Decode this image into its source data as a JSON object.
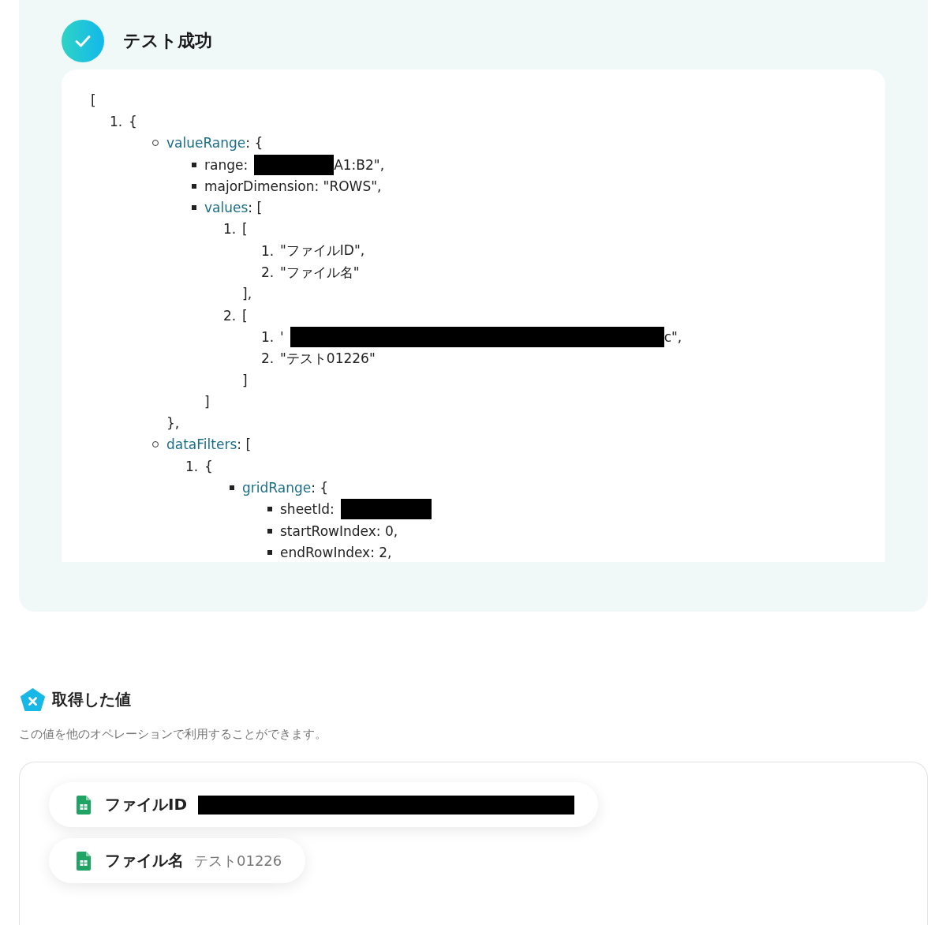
{
  "result": {
    "title": "テスト成功",
    "code": {
      "kind": "plain",
      "segments": [
        {
          "kind": "text",
          "text": "["
        }
      ],
      "children": [
        {
          "kind": "numbered",
          "number": "1.",
          "segments": [
            {
              "kind": "text",
              "text": "{"
            }
          ],
          "children": [
            {
              "kind": "circle",
              "segments": [
                {
                  "kind": "key",
                  "text": "valueRange"
                },
                {
                  "kind": "text",
                  "text": ": {"
                }
              ],
              "close": "},",
              "children": [
                {
                  "kind": "square",
                  "segments": [
                    {
                      "kind": "text",
                      "text": "range:"
                    },
                    {
                      "kind": "redaction"
                    },
                    {
                      "kind": "text",
                      "text": "A1:B2\","
                    }
                  ]
                },
                {
                  "kind": "square",
                  "segments": [
                    {
                      "kind": "text",
                      "text": "majorDimension: \"ROWS\","
                    }
                  ]
                },
                {
                  "kind": "square",
                  "segments": [
                    {
                      "kind": "key",
                      "text": "values"
                    },
                    {
                      "kind": "text",
                      "text": ": ["
                    }
                  ],
                  "close": "]",
                  "children": [
                    {
                      "kind": "numbered",
                      "number": "1.",
                      "segments": [
                        {
                          "kind": "text",
                          "text": "["
                        }
                      ],
                      "close": "],",
                      "children": [
                        {
                          "kind": "numbered",
                          "number": "1.",
                          "segments": [
                            {
                              "kind": "text",
                              "text": "\"ファイルID\","
                            }
                          ]
                        },
                        {
                          "kind": "numbered",
                          "number": "2.",
                          "segments": [
                            {
                              "kind": "text",
                              "text": "\"ファイル名\""
                            }
                          ]
                        }
                      ]
                    },
                    {
                      "kind": "numbered",
                      "number": "2.",
                      "segments": [
                        {
                          "kind": "text",
                          "text": "["
                        }
                      ],
                      "close": "]",
                      "children": [
                        {
                          "kind": "numbered",
                          "number": "1.",
                          "segments": [
                            {
                              "kind": "text",
                              "text": "'"
                            },
                            {
                              "kind": "redaction"
                            },
                            {
                              "kind": "text",
                              "text": "c\","
                            }
                          ]
                        },
                        {
                          "kind": "numbered",
                          "number": "2.",
                          "segments": [
                            {
                              "kind": "text",
                              "text": "\"テスト01226\""
                            }
                          ]
                        }
                      ]
                    }
                  ]
                }
              ]
            },
            {
              "kind": "circle",
              "segments": [
                {
                  "kind": "key",
                  "text": "dataFilters"
                },
                {
                  "kind": "text",
                  "text": ": ["
                }
              ],
              "children": [
                {
                  "kind": "numbered",
                  "number": "1.",
                  "segments": [
                    {
                      "kind": "text",
                      "text": "{"
                    }
                  ],
                  "children": [
                    {
                      "kind": "square",
                      "segments": [
                        {
                          "kind": "key",
                          "text": "gridRange"
                        },
                        {
                          "kind": "text",
                          "text": ": {"
                        }
                      ],
                      "children": [
                        {
                          "kind": "square",
                          "segments": [
                            {
                              "kind": "text",
                              "text": "sheetId:"
                            },
                            {
                              "kind": "redaction"
                            }
                          ]
                        },
                        {
                          "kind": "square",
                          "segments": [
                            {
                              "kind": "text",
                              "text": "startRowIndex: 0,"
                            }
                          ]
                        },
                        {
                          "kind": "square",
                          "segments": [
                            {
                              "kind": "text",
                              "text": "endRowIndex: 2,"
                            }
                          ]
                        }
                      ]
                    }
                  ]
                }
              ]
            }
          ]
        }
      ]
    }
  },
  "values_section": {
    "title": "取得した値",
    "description": "この値を他のオペレーションで利用することができます。",
    "items": [
      {
        "label": "ファイルID",
        "kind": "redacted"
      },
      {
        "label": "ファイル名",
        "kind": "text",
        "value": "テスト01226"
      }
    ]
  }
}
